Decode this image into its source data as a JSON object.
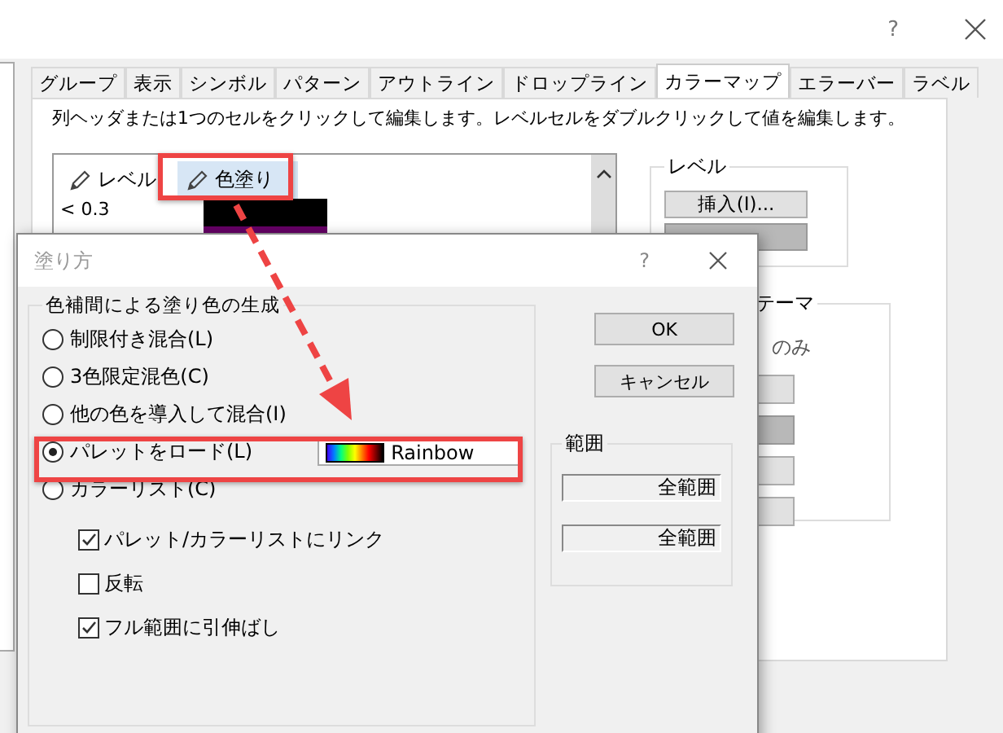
{
  "window": {
    "help": "?"
  },
  "tabs": [
    {
      "label": "グループ",
      "selected": false
    },
    {
      "label": "表示",
      "selected": false
    },
    {
      "label": "シンボル",
      "selected": false
    },
    {
      "label": "パターン",
      "selected": false
    },
    {
      "label": "アウトライン",
      "selected": false
    },
    {
      "label": "ドロップライン",
      "selected": false
    },
    {
      "label": "カラーマップ",
      "selected": true
    },
    {
      "label": "エラーバー",
      "selected": false
    },
    {
      "label": "ラベル",
      "selected": false
    }
  ],
  "hint": "列ヘッダまたは1つのセルをクリックして編集します。レベルセルをダブルクリックして値を編集します。",
  "level_table": {
    "columns": [
      {
        "label": "レベル",
        "selected": false
      },
      {
        "label": "色塗り",
        "selected": true
      }
    ],
    "rows": [
      {
        "level": "< 0.3",
        "color": "#000000"
      },
      {
        "color": "#660066"
      }
    ]
  },
  "level_group": {
    "title": "レベル",
    "buttons": [
      {
        "label": "挿入(I)...",
        "disabled": false
      },
      {
        "disabled": true
      }
    ]
  },
  "theme_group": {
    "title": "テーマ",
    "text": "のみ",
    "buttons": [
      {
        "disabled": false
      },
      {
        "disabled": true
      },
      {
        "disabled": false
      },
      {
        "disabled": false
      }
    ]
  },
  "dialog": {
    "title": "塗り方",
    "help": "?",
    "group": {
      "title": "色補間による塗り色の生成",
      "options": [
        {
          "label": "制限付き混合(L)",
          "selected": false
        },
        {
          "label": "3色限定混色(C)",
          "selected": false
        },
        {
          "label": "他の色を導入して混合(I)",
          "selected": false
        },
        {
          "label": "パレットをロード(L)",
          "selected": true
        },
        {
          "label": "カラーリスト(C)",
          "selected": false
        }
      ],
      "palette": "Rainbow",
      "checks": [
        {
          "label": "パレット/カラーリストにリンク",
          "checked": true
        },
        {
          "label": "反転",
          "checked": false
        },
        {
          "label": "フル範囲に引伸ばし",
          "checked": true
        }
      ]
    },
    "buttons": [
      "OK",
      "キャンセル"
    ],
    "range": {
      "title": "範囲",
      "fields": [
        "全範囲",
        "全範囲"
      ]
    }
  }
}
